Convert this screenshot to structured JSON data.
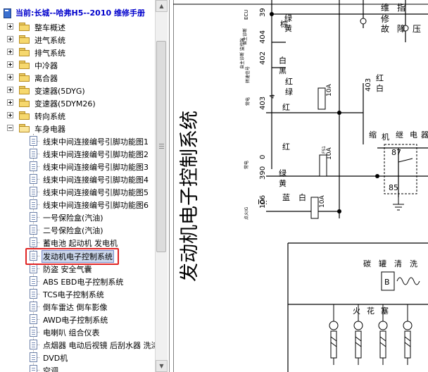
{
  "tree": {
    "title": "当前:长城--哈弗H5--2010 维修手册",
    "folders": [
      {
        "label": "整车概述",
        "expanded": false
      },
      {
        "label": "进气系统",
        "expanded": false
      },
      {
        "label": "排气系统",
        "expanded": false
      },
      {
        "label": "中冷器",
        "expanded": false
      },
      {
        "label": "离合器",
        "expanded": false
      },
      {
        "label": "变速器(5DYG)",
        "expanded": false
      },
      {
        "label": "变速器(5DYM26)",
        "expanded": false
      },
      {
        "label": "转向系统",
        "expanded": false
      },
      {
        "label": "车身电器",
        "expanded": true
      }
    ],
    "documents": [
      "线束中间连接编号引脚功能图1",
      "线束中间连接编号引脚功能图2",
      "线束中间连接编号引脚功能图3",
      "线束中间连接编号引脚功能图4",
      "线束中间连接编号引脚功能图5",
      "线束中间连接编号引脚功能图6",
      "一号保险盒(汽油)",
      "二号保险盒(汽油)",
      "蓄电池 起动机 发电机",
      "发动机电子控制系统",
      "防盗 安全气囊",
      "ABS EBD电子控制系统",
      "TCS电子控制系统",
      "倒车雷达 倒车影像",
      "AWD电子控制系统",
      "电喇叭 组合仪表",
      "点烟器 电动后视镜 后刮水器 洗涤",
      "DVD机",
      "空调"
    ],
    "selected_document": "发动机电子控制系统"
  },
  "diagram": {
    "title": "发动机电子控制系统",
    "wires": [
      {
        "num": "39",
        "color": "绿 黄"
      },
      {
        "num": "404",
        "color": "棕"
      },
      {
        "num": "402",
        "color": "白 黑"
      },
      {
        "num": "403",
        "color": "红"
      },
      {
        "num": "4",
        "color": "红 绿"
      },
      {
        "num": "403",
        "color": "红 白"
      },
      {
        "num": "0",
        "color": "红"
      },
      {
        "num": "390",
        "color": "绿 黄"
      },
      {
        "num": "106",
        "color": "蓝"
      },
      {
        "num": "",
        "color": "白"
      }
    ],
    "fuses": [
      {
        "label": "10A",
        "tag": "ECU电源保险"
      },
      {
        "label": "10A",
        "tag": "FS1"
      },
      {
        "label": "10A",
        "tag": "ECU电源"
      }
    ],
    "side_labels": [
      "ECU",
      "自主诊断",
      "自主诊断\n监控端",
      "转速信号",
      "常电",
      "常电",
      "点火IG"
    ],
    "ig_label": "IG:",
    "right_labels": [
      "维",
      "修",
      "指",
      "故",
      "障",
      "压",
      "缩",
      "机",
      "继",
      "电",
      "器",
      "碳",
      "罐",
      "清",
      "洗",
      "火",
      "花",
      "塞"
    ],
    "relay_pins": [
      "87",
      "85",
      "B"
    ]
  }
}
